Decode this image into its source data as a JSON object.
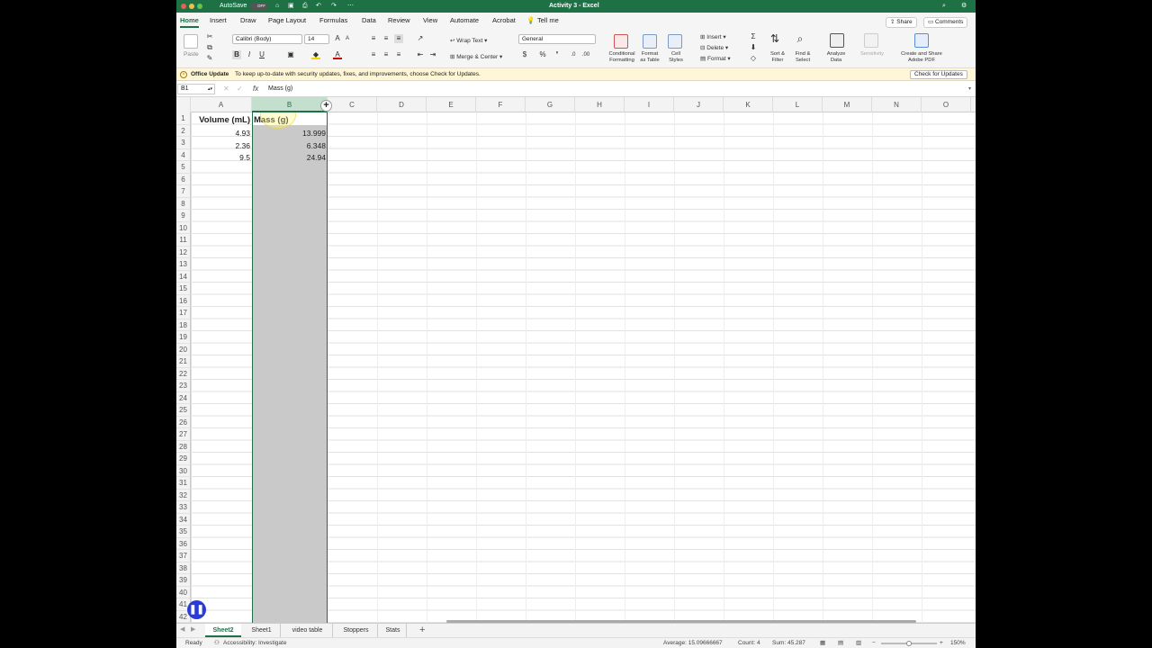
{
  "window": {
    "title": "Activity 3 - Excel",
    "autosave": "AutoSave",
    "autosave_state": "OFF"
  },
  "tabs": [
    "Home",
    "Insert",
    "Draw",
    "Page Layout",
    "Formulas",
    "Data",
    "Review",
    "View",
    "Automate",
    "Acrobat",
    "Tell me"
  ],
  "share": "Share",
  "comments": "Comments",
  "ribbon": {
    "paste": "Paste",
    "font": "Calibri (Body)",
    "size": "14",
    "wrap": "Wrap Text",
    "merge": "Merge & Center",
    "number_format": "General",
    "conditional": "Conditional Formatting",
    "format_table": "Format as Table",
    "cell_styles": "Cell Styles",
    "insert": "Insert",
    "delete": "Delete",
    "format": "Format",
    "sort_filter": "Sort & Filter",
    "find_select": "Find & Select",
    "analyze": "Analyze Data",
    "sensitivity": "Sensitivity",
    "adobe": "Create and Share Adobe PDF",
    "bold": "B",
    "italic": "I",
    "underline": "U"
  },
  "message": {
    "title": "Office Update",
    "text": "To keep up-to-date with security updates, fixes, and improvements, choose Check for Updates.",
    "button": "Check for Updates"
  },
  "formula": {
    "name_box": "B1",
    "fx": "fx",
    "content": "Mass (g)"
  },
  "columns": [
    "A",
    "B",
    "C",
    "D",
    "E",
    "F",
    "G",
    "H",
    "I",
    "J",
    "K",
    "L",
    "M",
    "N",
    "O"
  ],
  "cells": {
    "a1": "Volume (mL)",
    "b1": "Mass (g)",
    "a2": "4.93",
    "b2": "13.999",
    "a3": "2.36",
    "b3": "6.348",
    "a4": "9.5",
    "b4": "24.94"
  },
  "sheets": [
    "Sheet2",
    "Sheet1",
    "video table",
    "Stoppers",
    "Stats"
  ],
  "active_sheet": "Sheet2",
  "status": {
    "ready": "Ready",
    "accessibility": "Accessibility: Investigate",
    "average": "Average: 15.09666667",
    "count": "Count: 4",
    "sum": "Sum: 45.287",
    "zoom": "150%"
  }
}
